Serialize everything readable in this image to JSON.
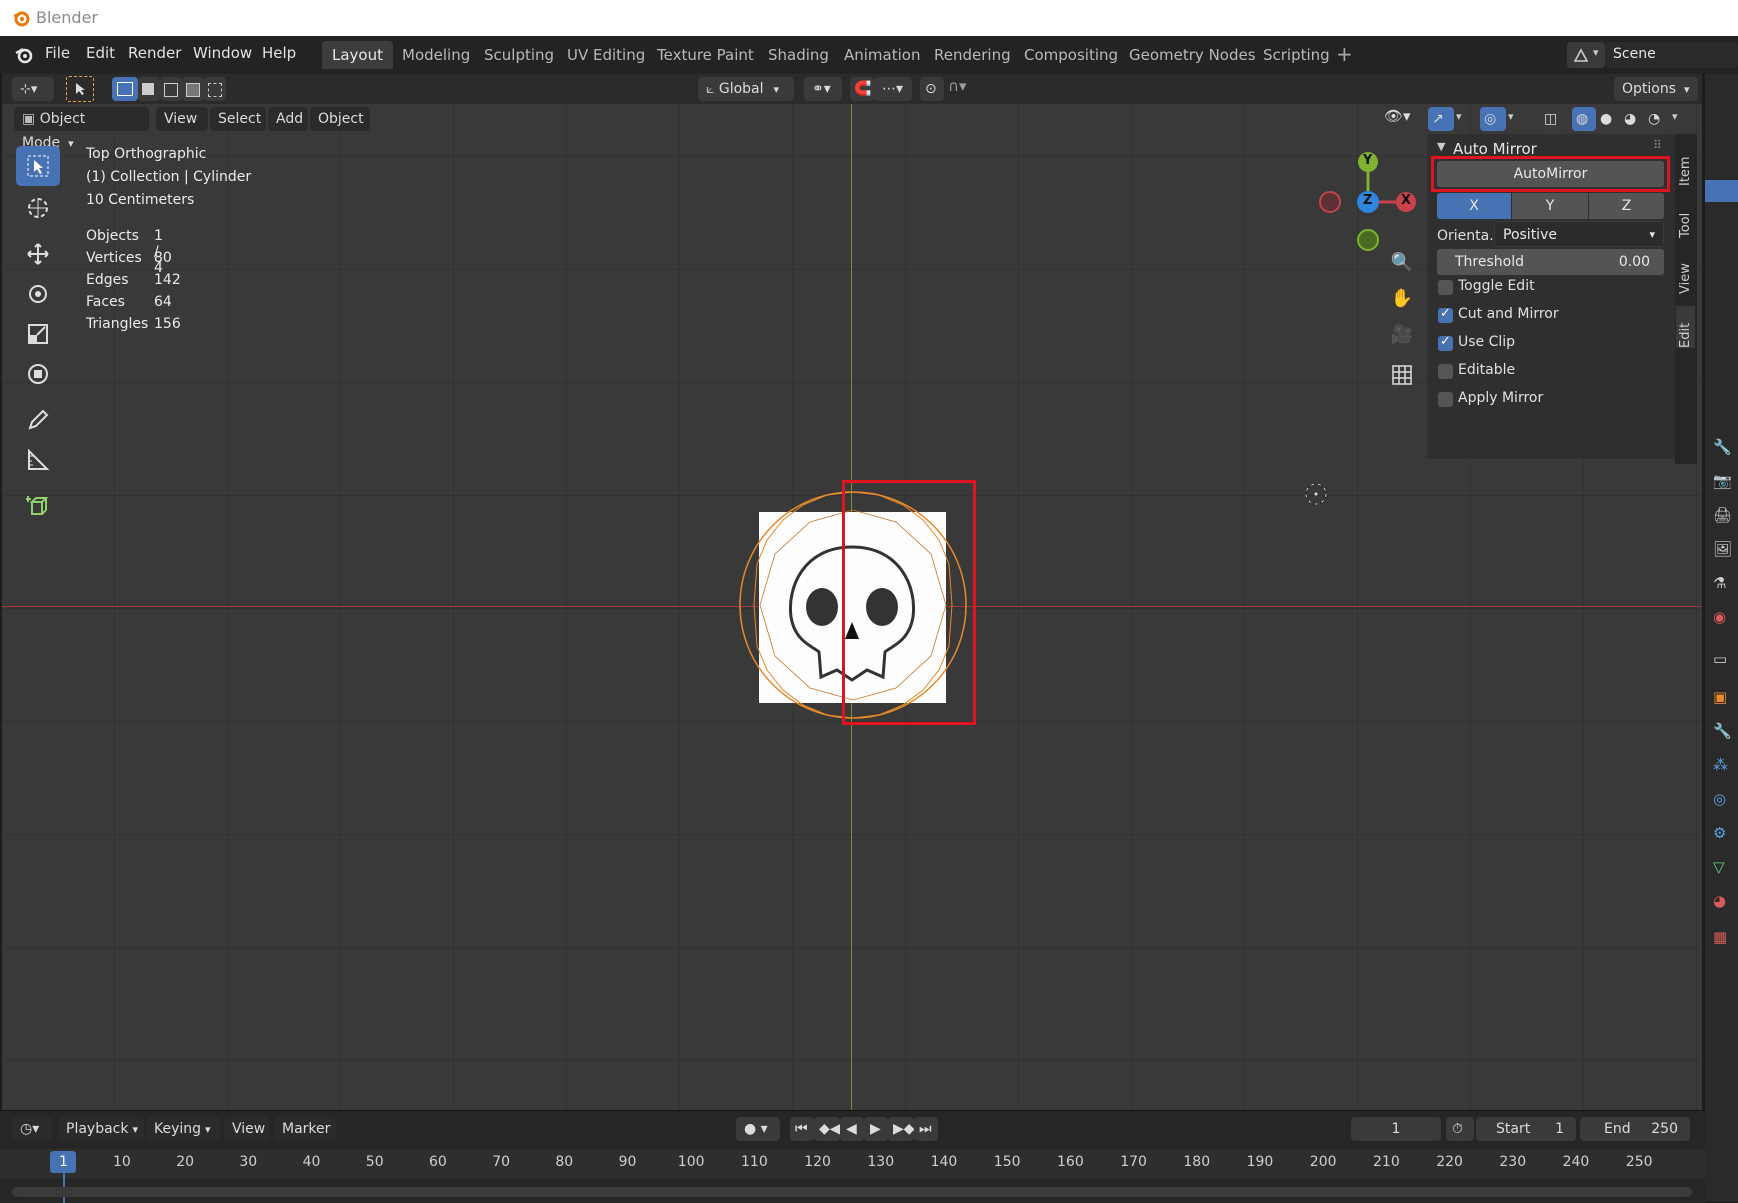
{
  "app": {
    "title": "Blender"
  },
  "menu": [
    "File",
    "Edit",
    "Render",
    "Window",
    "Help"
  ],
  "workspaces": [
    "Layout",
    "Modeling",
    "Sculpting",
    "UV Editing",
    "Texture Paint",
    "Shading",
    "Animation",
    "Rendering",
    "Compositing",
    "Geometry Nodes",
    "Scripting"
  ],
  "active_workspace": "Layout",
  "scene": {
    "name": "Scene"
  },
  "header": {
    "transform_orientation": "Global",
    "options_label": "Options",
    "mode": "Object Mode",
    "view_menus": [
      "View",
      "Select",
      "Add",
      "Object"
    ]
  },
  "viewport": {
    "view_name": "Top Orthographic",
    "collection_line": "(1) Collection | Cylinder",
    "scale_text": "10 Centimeters",
    "stats": [
      {
        "label": "Objects",
        "value": "1 / 4"
      },
      {
        "label": "Vertices",
        "value": "80"
      },
      {
        "label": "Edges",
        "value": "142"
      },
      {
        "label": "Faces",
        "value": "64"
      },
      {
        "label": "Triangles",
        "value": "156"
      }
    ],
    "gizmo": {
      "x": "X",
      "y": "Y",
      "z": "Z"
    }
  },
  "panel": {
    "title": "Auto Mirror",
    "automirror_button": "AutoMirror",
    "axes": [
      "X",
      "Y",
      "Z"
    ],
    "active_axis": "X",
    "orientation_label": "Orienta...",
    "orientation_value": "Positive",
    "threshold_label": "Threshold",
    "threshold_value": "0.00",
    "checkboxes": [
      {
        "label": "Toggle Edit",
        "checked": false
      },
      {
        "label": "Cut and Mirror",
        "checked": true
      },
      {
        "label": "Use Clip",
        "checked": true
      },
      {
        "label": "Editable",
        "checked": false
      },
      {
        "label": "Apply Mirror",
        "checked": false
      }
    ],
    "tabs": [
      "Item",
      "Tool",
      "View",
      "Edit"
    ]
  },
  "timeline": {
    "menus": [
      "Playback",
      "Keying",
      "View",
      "Marker"
    ],
    "current_frame": "1",
    "start_label": "Start",
    "start_value": "1",
    "end_label": "End",
    "end_value": "250",
    "ticks": [
      "1",
      "10",
      "20",
      "30",
      "40",
      "50",
      "60",
      "70",
      "80",
      "90",
      "100",
      "110",
      "120",
      "130",
      "140",
      "150",
      "160",
      "170",
      "180",
      "190",
      "200",
      "210",
      "220",
      "230",
      "240",
      "250"
    ]
  },
  "colors": {
    "accent": "#4772b3",
    "highlight_box": "#e0141e",
    "selection_orange": "#e8892b",
    "x_axis": "#c8414b",
    "y_axis": "#7fb22f",
    "z_axis": "#2e86de"
  }
}
